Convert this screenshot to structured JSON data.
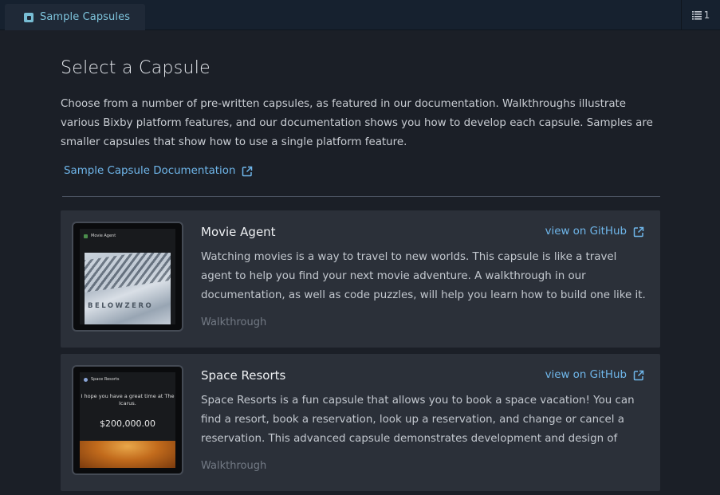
{
  "tab": {
    "label": "Sample Capsules",
    "icon": "capsule-icon"
  },
  "toolbar": {
    "list_count": "1",
    "icon": "list-icon"
  },
  "page": {
    "title": "Select a Capsule",
    "intro": "Choose from a number of pre-written capsules, as featured in our documentation. Walkthroughs illustrate various Bixby platform features, and our documentation shows you how to develop each capsule. Samples are smaller capsules that show how to use a single platform feature.",
    "doc_link": "Sample Capsule Documentation"
  },
  "capsules": [
    {
      "title": "Movie Agent",
      "github_label": "view on GitHub",
      "description": "Watching movies is a way to travel to new worlds. This capsule is like a travel agent to help you find your next movie adventure. A walkthrough in our documentation, as well as code puzzles, will help you learn how to build one like it.",
      "tag": "Walkthrough",
      "thumb": {
        "header": "Movie Agent",
        "art_text": "BELOWZERO"
      }
    },
    {
      "title": "Space Resorts",
      "github_label": "view on GitHub",
      "description": "Space Resorts is a fun capsule that allows you to book a space vacation! You can find a resort, book a reservation, look up a reservation, and change or cancel a reservation. This advanced capsule demonstrates development and design of searches, transactio…",
      "tag": "Walkthrough",
      "thumb": {
        "header": "Space Resorts",
        "message": "I hope you have a great time at The Icarus.",
        "price": "$200,000.00"
      }
    }
  ],
  "colors": {
    "link": "#6fb6ea",
    "tab_accent": "#7ec4dc",
    "card_bg": "#2b3039",
    "page_bg": "#1b1f27"
  }
}
